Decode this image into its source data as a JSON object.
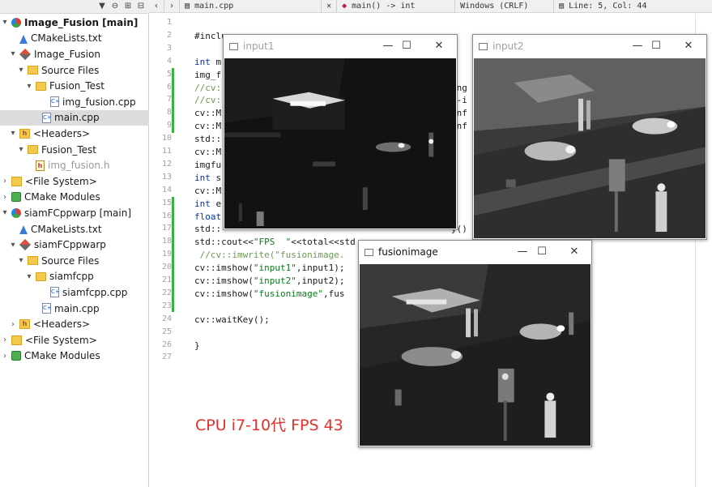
{
  "sidebar": {
    "toolbar_icons": [
      "filter-icon",
      "link-icon",
      "split-icon",
      "collapse-icon"
    ],
    "tree": [
      {
        "label": "Image_Fusion [main]",
        "icon": "cmake-root-icon",
        "bold": true,
        "chev": "▾"
      },
      {
        "label": "CMakeLists.txt",
        "icon": "cmake-icon",
        "chev": ""
      },
      {
        "label": "Image_Fusion",
        "icon": "project-icon",
        "chev": "▾"
      },
      {
        "label": "Source Files",
        "icon": "source-folder-icon",
        "chev": "▾"
      },
      {
        "label": "Fusion_Test",
        "icon": "folder-icon",
        "chev": "▾"
      },
      {
        "label": "img_fusion.cpp",
        "icon": "cpp-file-icon",
        "chev": ""
      },
      {
        "label": "main.cpp",
        "icon": "cpp-file-icon",
        "chev": "",
        "selected": true
      },
      {
        "label": "<Headers>",
        "icon": "headers-icon",
        "chev": "▾"
      },
      {
        "label": "Fusion_Test",
        "icon": "folder-icon",
        "chev": "▾"
      },
      {
        "label": "img_fusion.h",
        "icon": "header-file-icon",
        "chev": "",
        "grey": true
      },
      {
        "label": "<File System>",
        "icon": "filesystem-icon",
        "chev": "›"
      },
      {
        "label": "CMake Modules",
        "icon": "cmake-modules-icon",
        "chev": "›"
      },
      {
        "label": "siamFCppwarp [main]",
        "icon": "cmake-root-icon",
        "chev": "▾"
      },
      {
        "label": "CMakeLists.txt",
        "icon": "cmake-icon",
        "chev": ""
      },
      {
        "label": "siamFCppwarp",
        "icon": "project-icon",
        "chev": "▾"
      },
      {
        "label": "Source Files",
        "icon": "source-folder-icon",
        "chev": "▾"
      },
      {
        "label": "siamfcpp",
        "icon": "folder-icon",
        "chev": "▾"
      },
      {
        "label": "siamfcpp.cpp",
        "icon": "cpp-file-icon",
        "chev": ""
      },
      {
        "label": "main.cpp",
        "icon": "cpp-file-icon",
        "chev": ""
      },
      {
        "label": "<Headers>",
        "icon": "headers-icon",
        "chev": "›"
      },
      {
        "label": "<File System>",
        "icon": "filesystem-icon",
        "chev": "›"
      },
      {
        "label": "CMake Modules",
        "icon": "cmake-modules-icon",
        "chev": "›"
      }
    ]
  },
  "editor": {
    "file_name": "main.cpp",
    "function_crumb": "main() -> int",
    "encoding": "Windows (CRLF)",
    "cursor": "Line: 5, Col: 44",
    "line_numbers": [
      "1",
      "2",
      "3",
      "4",
      "5",
      "6",
      "7",
      "8",
      "9",
      "10",
      "11",
      "12",
      "13",
      "14",
      "15",
      "16",
      "17",
      "18",
      "19",
      "20",
      "21",
      "22",
      "23",
      "24",
      "25",
      "26",
      "27"
    ],
    "code_lines": [
      "",
      "#inclu",
      "",
      "int m",
      "img_f",
      "//cv:",
      "//cv:",
      "cv::M",
      "cv::M",
      "std::",
      "cv::M",
      "imgfu",
      "int s",
      "cv::M",
      "int e",
      "float",
      "std::",
      "std::cout<<\"FPS  \"<<total<<std",
      " //cv::imwrite(\"fusionimage.",
      "cv::imshow(\"input1\",input1);",
      "cv::imshow(\"input2\",input2);",
      "cv::imshow(\"fusionimage\",fus",
      "",
      "cv::waitKey();",
      "",
      "}",
      ""
    ],
    "code_right_fragments": {
      "line5": "ong",
      "line6": "e-i",
      "line7": "inf",
      "line8": "inf",
      "line15": ";",
      "line16": "y()"
    },
    "note": "CPU i7-10代  FPS 43"
  },
  "windows": {
    "input1": {
      "title": "input1"
    },
    "input2": {
      "title": "input2"
    },
    "fusion": {
      "title": "fusionimage"
    },
    "controls": {
      "minimize": "—",
      "maximize": "☐",
      "close": "✕"
    }
  }
}
